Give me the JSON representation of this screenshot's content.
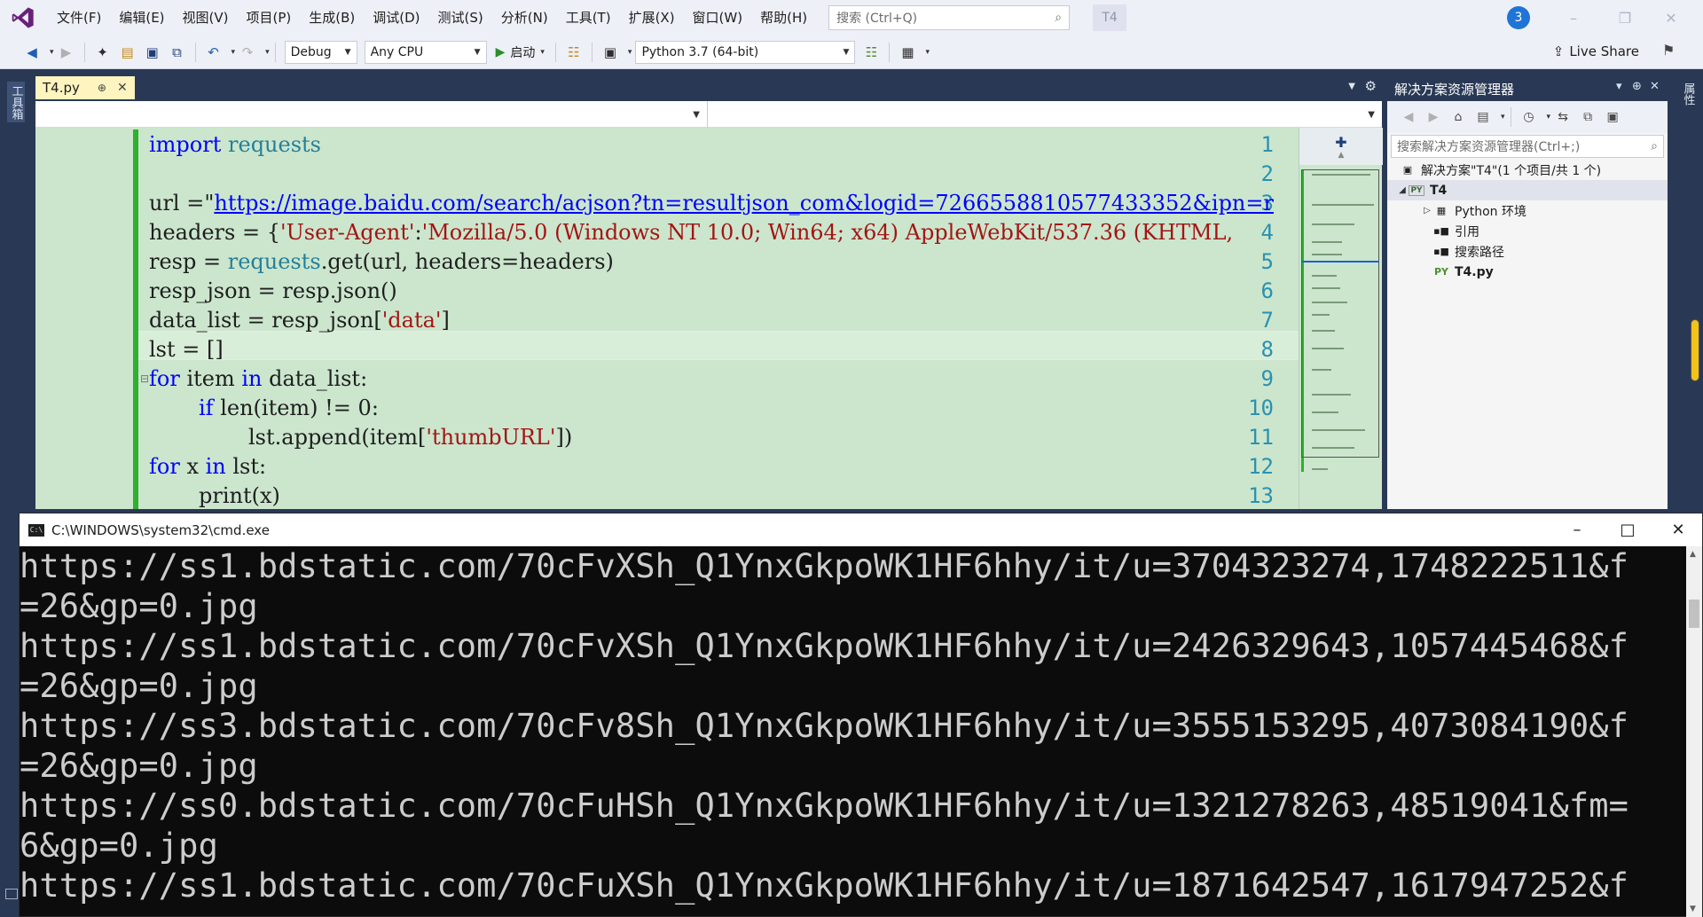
{
  "menubar": {
    "items": [
      "文件(F)",
      "编辑(E)",
      "视图(V)",
      "项目(P)",
      "生成(B)",
      "调试(D)",
      "测试(S)",
      "分析(N)",
      "工具(T)",
      "扩展(X)",
      "窗口(W)",
      "帮助(H)"
    ],
    "search_placeholder": "搜索 (Ctrl+Q)",
    "solution_name": "T4",
    "notification_count": "3"
  },
  "toolbar": {
    "config": "Debug",
    "platform": "Any CPU",
    "start_label": "启动",
    "env": "Python 3.7 (64-bit)",
    "live_share": "Live Share"
  },
  "side_tabs": {
    "toolbox": "工具箱",
    "properties": "属性"
  },
  "editor": {
    "tab_name": "T4.py",
    "line_numbers": [
      "1",
      "2",
      "3",
      "4",
      "5",
      "6",
      "7",
      "8",
      "9",
      "10",
      "11",
      "12",
      "13"
    ],
    "code": {
      "l1_kw": "import",
      "l1_mod": "requests",
      "l3_pre": "url =\"",
      "l3_url": "https://image.baidu.com/search/acjson?tn=resultjson_com&logid=7266558810577433352&ipn=r",
      "l4_pre": "headers = {",
      "l4_s1": "'User-Agent'",
      "l4_mid": ":",
      "l4_s2": "'Mozilla/5.0 (Windows NT 10.0; Win64; x64) AppleWebKit/537.36 (KHTML,",
      "l5_pre": "resp = ",
      "l5_fn": "requests",
      "l5_post": ".get(url, headers=headers)",
      "l6": "resp_json = resp.json()",
      "l7_pre": "data_list = resp_json[",
      "l7_str": "'data'",
      "l7_post": "]",
      "l8": "lst = []",
      "l9_kw1": "for",
      "l9_mid": " item ",
      "l9_kw2": "in",
      "l9_post": " data_list:",
      "l10_kw": "if",
      "l10_post": " len(item) != 0:",
      "l11_pre": "lst.append(item[",
      "l11_str": "'thumbURL'",
      "l11_post": "])",
      "l12_kw1": "for",
      "l12_mid": " x ",
      "l12_kw2": "in",
      "l12_post": " lst:",
      "l13": "print(x)"
    }
  },
  "solution_explorer": {
    "title": "解决方案资源管理器",
    "search_placeholder": "搜索解决方案资源管理器(Ctrl+;)",
    "solution_label": "解决方案\"T4\"(1 个项目/共 1 个)",
    "project": "T4",
    "python_env": "Python 环境",
    "references": "引用",
    "search_paths": "搜索路径",
    "file": "T4.py"
  },
  "cmd": {
    "title": "C:\\WINDOWS\\system32\\cmd.exe",
    "lines": [
      "https://ss1.bdstatic.com/70cFvXSh_Q1YnxGkpoWK1HF6hhy/it/u=3704323274,1748222511&f",
      "=26&gp=0.jpg",
      "https://ss1.bdstatic.com/70cFvXSh_Q1YnxGkpoWK1HF6hhy/it/u=2426329643,1057445468&f",
      "=26&gp=0.jpg",
      "https://ss3.bdstatic.com/70cFv8Sh_Q1YnxGkpoWK1HF6hhy/it/u=3555153295,4073084190&f",
      "=26&gp=0.jpg",
      "https://ss0.bdstatic.com/70cFuHSh_Q1YnxGkpoWK1HF6hhy/it/u=1321278263,48519041&fm=",
      "6&gp=0.jpg",
      "https://ss1.bdstatic.com/70cFuXSh_Q1YnxGkpoWK1HF6hhy/it/u=1871642547,1617947252&f"
    ]
  },
  "colors": {
    "editor_bg": "#cbe6cd",
    "keyword": "#0000ff",
    "string": "#a31515",
    "chrome": "#293955",
    "accent": "#1f74d6"
  }
}
